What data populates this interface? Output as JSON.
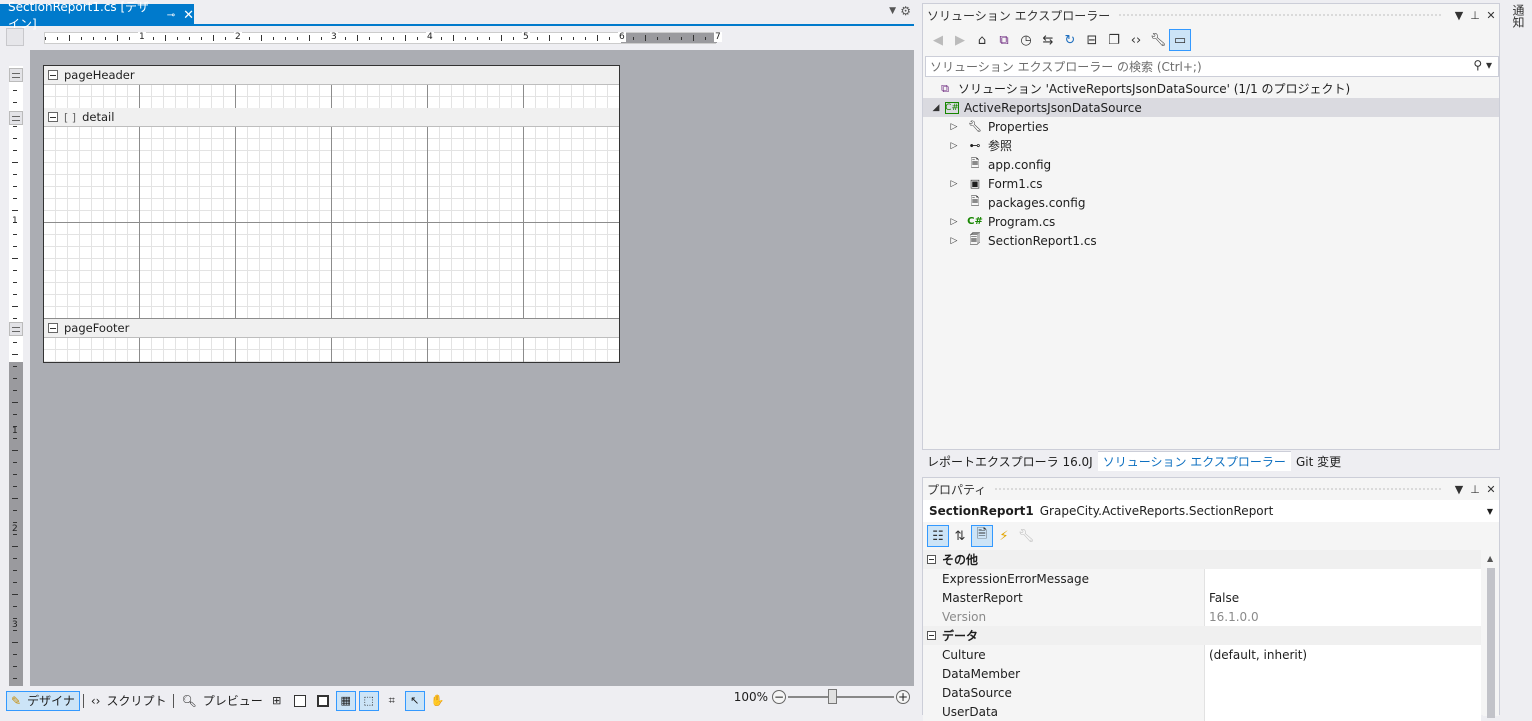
{
  "document_tab": {
    "title": "SectionReport1.cs [デザイン]",
    "pin": "⊸",
    "close": "✕"
  },
  "ruler": {
    "h_numbers": [
      "1",
      "2",
      "3",
      "4",
      "5",
      "6",
      "7"
    ],
    "v_numbers": [
      "1",
      "1",
      "2",
      "3"
    ]
  },
  "report": {
    "sections": [
      {
        "label": "pageHeader"
      },
      {
        "label": "detail"
      },
      {
        "label": "pageFooter"
      }
    ]
  },
  "bottom_bar": {
    "designer": "デザイナ",
    "script": "スクリプト",
    "preview": "プレビュー",
    "zoom": "100%",
    "zoom_minus": "−",
    "zoom_plus": "+"
  },
  "solution_explorer": {
    "title": "ソリューション エクスプローラー",
    "search_placeholder": "ソリューション エクスプローラー の検索 (Ctrl+;)",
    "solution": "ソリューション 'ActiveReportsJsonDataSource' (1/1 のプロジェクト)",
    "project": "ActiveReportsJsonDataSource",
    "items": [
      {
        "label": "Properties",
        "icon": "wrench-icon",
        "expandable": true
      },
      {
        "label": "参照",
        "icon": "references-icon",
        "expandable": true
      },
      {
        "label": "app.config",
        "icon": "config-file-icon",
        "expandable": false
      },
      {
        "label": "Form1.cs",
        "icon": "form-icon",
        "expandable": true
      },
      {
        "label": "packages.config",
        "icon": "config-file-icon",
        "expandable": false
      },
      {
        "label": "Program.cs",
        "icon": "csharp-icon",
        "expandable": true
      },
      {
        "label": "SectionReport1.cs",
        "icon": "report-file-icon",
        "expandable": true
      }
    ]
  },
  "pane_tabs": [
    "レポートエクスプローラ 16.0J",
    "ソリューション エクスプローラー",
    "Git 変更"
  ],
  "properties": {
    "title": "プロパティ",
    "object_name": "SectionReport1",
    "object_type": "GrapeCity.ActiveReports.SectionReport",
    "categories": [
      {
        "name": "その他",
        "rows": [
          {
            "name": "ExpressionErrorMessage",
            "value": ""
          },
          {
            "name": "MasterReport",
            "value": "False"
          },
          {
            "name": "Version",
            "value": "16.1.0.0"
          }
        ]
      },
      {
        "name": "データ",
        "rows": [
          {
            "name": "Culture",
            "value": "(default, inherit)"
          },
          {
            "name": "DataMember",
            "value": ""
          },
          {
            "name": "DataSource",
            "value": ""
          },
          {
            "name": "UserData",
            "value": ""
          }
        ]
      }
    ]
  },
  "side_tab": {
    "label": "通知"
  },
  "colors": {
    "accent": "#007acc",
    "selection": "#cce4f7",
    "canvas": "#abadb3"
  }
}
